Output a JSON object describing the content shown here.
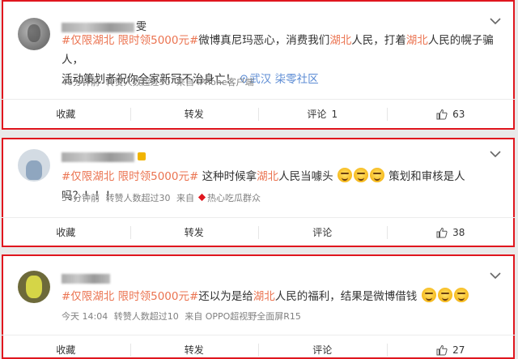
{
  "posts": [
    {
      "author_suffix": "雯",
      "hashtag": "#仅限湖北 限时领5000元#",
      "text_parts": [
        "微博真尼玛恶心，消费我们",
        "湖北",
        "人民，打着",
        "湖北",
        "人民的幌子骗人，",
        "活动策划者祝你全家新冠不治身亡！"
      ],
      "location": "武汉 柒零社区",
      "time": "46分钟前",
      "reposts": "转赞人数超过50",
      "source": "来自 iPhone客户端",
      "actions": {
        "favorite": "收藏",
        "repost": "转发",
        "comment": "评论",
        "comment_count": "1",
        "like_count": "63"
      }
    },
    {
      "author_suffix": "",
      "hashtag": "#仅限湖北 限时领5000元#",
      "text_parts": [
        " 这种时候拿",
        "湖北",
        "人民当噱头",
        "策划和审核是人吗？！！！"
      ],
      "time": "54分钟前",
      "reposts": "转赞人数超过30",
      "source": "来自",
      "source2": "热心吃瓜群众",
      "actions": {
        "favorite": "收藏",
        "repost": "转发",
        "comment": "评论",
        "comment_count": "",
        "like_count": "38"
      }
    },
    {
      "author_suffix": "",
      "hashtag": "#仅限湖北 限时领5000元#",
      "text_parts": [
        "还以为是给",
        "湖北",
        "人民的福利，结果是微博借钱"
      ],
      "time": "今天 14:04",
      "reposts": "转赞人数超过10",
      "source": "来自 OPPO超视野全面屏R15",
      "actions": {
        "favorite": "收藏",
        "repost": "转发",
        "comment": "评论",
        "comment_count": "",
        "like_count": "27"
      }
    }
  ],
  "icons": {
    "chevron": "chevron-down-icon",
    "like": "thumbs-up-icon",
    "location": "location-pin-icon",
    "source_badge": "diamond-badge-icon"
  },
  "colors": {
    "accent": "#eb7350",
    "link": "#5b8bd4",
    "border": "#e0161e"
  }
}
